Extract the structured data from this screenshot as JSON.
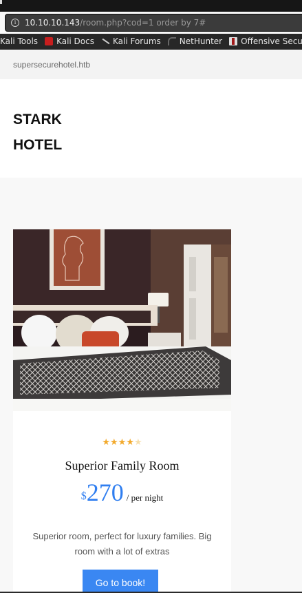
{
  "browser": {
    "url_host": "10.10.10.143",
    "url_path": "/room.php?cod=1 order by 7#",
    "bookmarks": [
      {
        "label": "Kali Tools",
        "icon": "none"
      },
      {
        "label": "Kali Docs",
        "icon": "kali-docs-icon"
      },
      {
        "label": "Kali Forums",
        "icon": "kali-forums-icon"
      },
      {
        "label": "NetHunter",
        "icon": "nethunter-icon"
      },
      {
        "label": "Offensive Secu",
        "icon": "offensive-security-icon"
      }
    ]
  },
  "site": {
    "domain": "supersecurehotel.htb",
    "brand_line1": "STARK",
    "brand_line2": "HOTEL"
  },
  "room": {
    "rating": 4,
    "rating_max": 5,
    "title": "Superior Family Room",
    "currency": "$",
    "price": "270",
    "per": "/ per night",
    "description": "Superior room, perfect for luxury families. Big room with a lot of extras",
    "book_label": "Go to book!"
  }
}
